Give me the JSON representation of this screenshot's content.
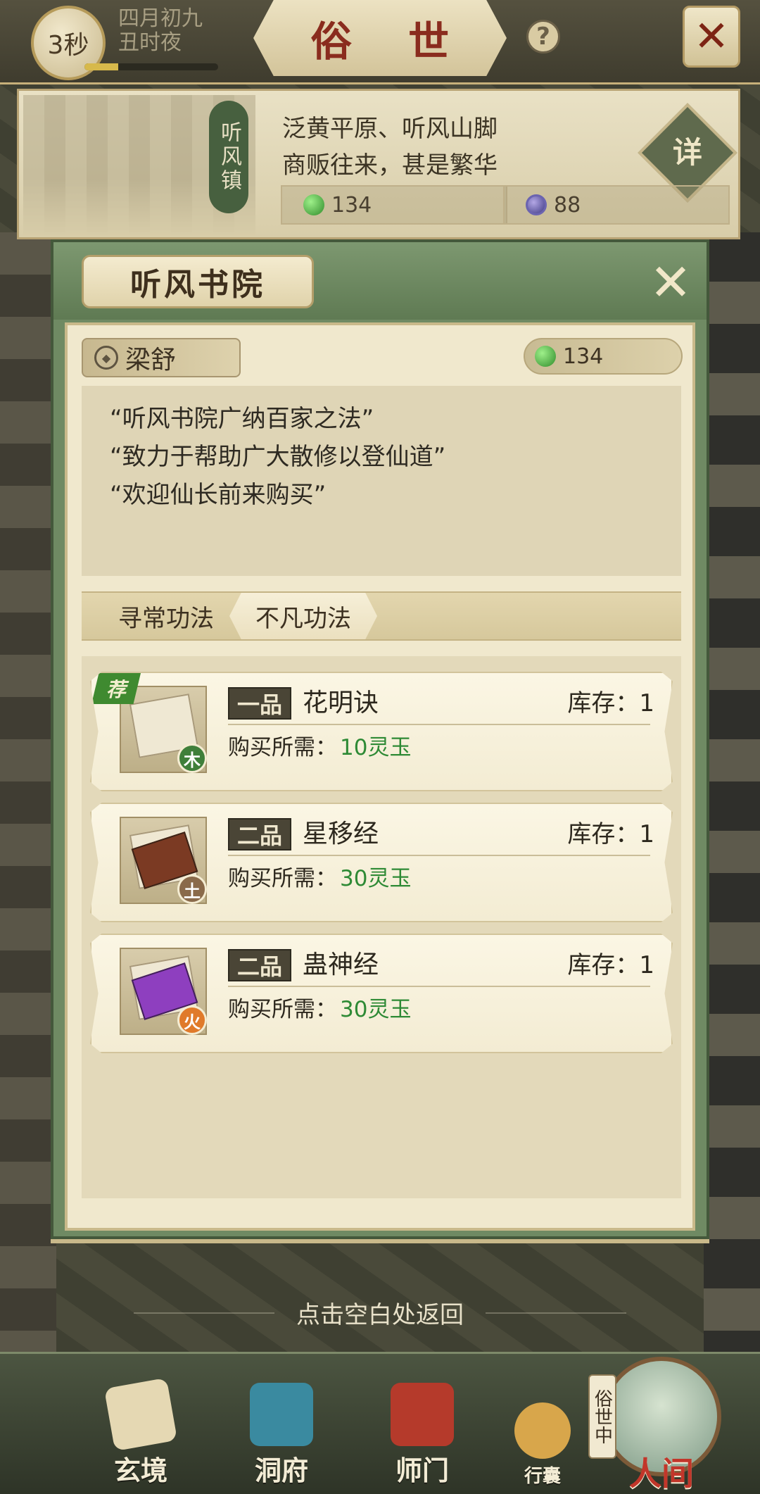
{
  "topbar": {
    "timer": "3秒",
    "date_line1": "四月初九",
    "date_line2": "丑时夜",
    "progress_fraction": 0.25,
    "title": "俗 世",
    "help_label": "?",
    "close_label": "✕"
  },
  "location": {
    "name": "听风镇",
    "desc_line1": "泛黄平原、听风山脚",
    "desc_line2": "商贩往来，甚是繁华",
    "detail_label": "详",
    "jade": "134",
    "coin": "88"
  },
  "modal": {
    "title": "听风书院",
    "close_label": "✕",
    "npc_name": "梁舒",
    "balance": "134",
    "quotes": [
      "“听风书院广纳百家之法”",
      "“致力于帮助广大散修以登仙道”",
      "“欢迎仙长前来购买”"
    ],
    "tabs": [
      "寻常功法",
      "不凡功法"
    ],
    "active_tab": 1,
    "items": [
      {
        "grade": "一品",
        "name": "花明诀",
        "stock_label": "库存：",
        "stock": "1",
        "cost_label": "购买所需：",
        "cost": "10灵玉",
        "element": "木",
        "element_color": "#3f7f3a",
        "recommended": true,
        "rec_label": "荐"
      },
      {
        "grade": "二品",
        "name": "星移经",
        "stock_label": "库存：",
        "stock": "1",
        "cost_label": "购买所需：",
        "cost": "30灵玉",
        "element": "土",
        "element_color": "#8a6a4a",
        "recommended": false
      },
      {
        "grade": "二品",
        "name": "蛊神经",
        "stock_label": "库存：",
        "stock": "1",
        "cost_label": "购买所需：",
        "cost": "30灵玉",
        "element": "火",
        "element_color": "#e07a2a",
        "recommended": false
      }
    ]
  },
  "hint": "点击空白处返回",
  "bottom_nav": [
    "玄境",
    "洞府",
    "师门",
    "行囊",
    "人间"
  ],
  "nav_band": "俗世中",
  "colors": {
    "accent_green": "#2e8a35",
    "title_red": "#8a2c1e"
  }
}
